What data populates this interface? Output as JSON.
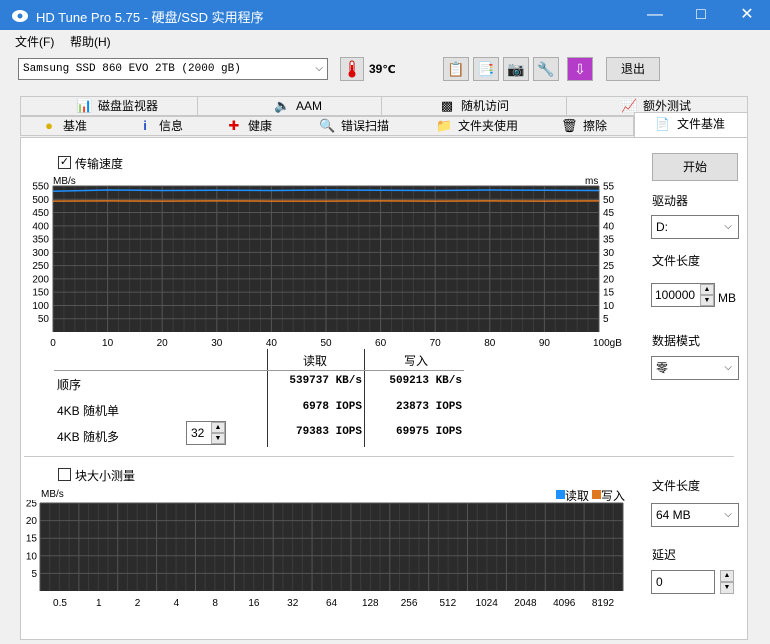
{
  "window": {
    "title": "HD Tune Pro 5.75 - 硬盘/SSD 实用程序"
  },
  "menu": {
    "file": "文件(F)",
    "help": "帮助(H)"
  },
  "toolbar": {
    "drive": "Samsung SSD 860 EVO 2TB (2000 gB)",
    "temperature": "39",
    "exit": "退出"
  },
  "tabs": {
    "row1": [
      "磁盘监视器",
      "AAM",
      "随机访问",
      "额外测试"
    ],
    "row2": [
      "基准",
      "信息",
      "健康",
      "错误扫描",
      "文件夹使用",
      "擦除",
      "文件基准"
    ]
  },
  "transfer": {
    "checkbox_label": "传输速度",
    "checked": true,
    "left_unit": "MB/s",
    "right_unit": "ms",
    "left_ticks": [
      "550",
      "500",
      "450",
      "400",
      "350",
      "300",
      "250",
      "200",
      "150",
      "100",
      "50"
    ],
    "right_ticks": [
      "55",
      "50",
      "45",
      "40",
      "35",
      "30",
      "25",
      "20",
      "15",
      "10",
      "5"
    ],
    "x_ticks": [
      "0",
      "10",
      "20",
      "30",
      "40",
      "50",
      "60",
      "70",
      "80",
      "90",
      "100gB"
    ]
  },
  "chart_data": [
    {
      "type": "line",
      "x": [
        0,
        10,
        20,
        30,
        40,
        50,
        60,
        70,
        80,
        90,
        100
      ],
      "series": [
        {
          "name": "读取",
          "values": [
            530,
            535,
            533,
            534,
            533,
            535,
            534,
            533,
            535,
            534,
            533
          ]
        },
        {
          "name": "写入",
          "values": [
            493,
            494,
            493,
            494,
            493,
            493,
            494,
            493,
            494,
            493,
            494
          ]
        }
      ],
      "xlabel": "gB",
      "ylabel": "MB/s",
      "ylim": [
        0,
        550
      ],
      "grid": true
    },
    {
      "type": "bar",
      "categories": [
        "0.5",
        "1",
        "2",
        "4",
        "8",
        "16",
        "32",
        "64",
        "128",
        "256",
        "512",
        "1024",
        "2048",
        "4096",
        "8192"
      ],
      "series": [
        {
          "name": "读取",
          "values": []
        },
        {
          "name": "写入",
          "values": []
        }
      ],
      "ylabel": "MB/s",
      "ylim": [
        0,
        25
      ],
      "grid": true,
      "legend": "top-right"
    }
  ],
  "results": {
    "col_read": "读取",
    "col_write": "写入",
    "rows": [
      {
        "label": "顺序",
        "read": "539737 KB/s",
        "write": "509213 KB/s"
      },
      {
        "label": "4KB 随机单",
        "read": "6978 IOPS",
        "write": "23873 IOPS"
      },
      {
        "label": "4KB 随机多",
        "read": "79383 IOPS",
        "write": "69975 IOPS"
      }
    ],
    "queue_depth": "32"
  },
  "block": {
    "checkbox_label": "块大小测量",
    "checked": false,
    "unit": "MB/s",
    "y_ticks": [
      "25",
      "20",
      "15",
      "10",
      "5"
    ],
    "legend_read": "读取",
    "legend_write": "写入"
  },
  "right": {
    "start": "开始",
    "drive_label": "驱动器",
    "drive_value": "D:",
    "file_length_label": "文件长度",
    "file_length_value": "100000",
    "file_length_unit": "MB",
    "data_mode_label": "数据模式",
    "data_mode_value": "零",
    "file_length2_label": "文件长度",
    "file_length2_value": "64 MB",
    "delay_label": "延迟",
    "delay_value": "0"
  },
  "colors": {
    "read": "#1e90ff",
    "write": "#e07820",
    "title_bar": "#2f7fd8",
    "chart_bg": "#2b2b2b"
  }
}
